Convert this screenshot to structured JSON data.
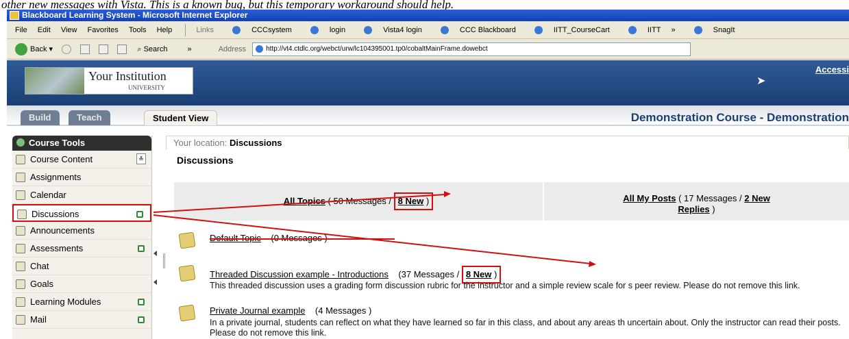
{
  "caption": "other new messages with Vista. This is a known bug, but this temporary workaround should help.",
  "window": {
    "title": "Blackboard Learning System - Microsoft Internet Explorer"
  },
  "menu": {
    "items": [
      "File",
      "Edit",
      "View",
      "Favorites",
      "Tools",
      "Help"
    ],
    "links_label": "Links",
    "links": [
      "CCCsystem",
      "login",
      "Vista4 login",
      "CCC Blackboard",
      "IITT_CourseCart",
      "IITT"
    ],
    "more": "»",
    "snagit": "SnagIt"
  },
  "toolbar": {
    "back": "Back",
    "search": "Search",
    "more": "»",
    "address_label": "Address",
    "address_value": "http://vt4.ctdlc.org/webct/urw/lc104395001.tp0/cobaltMainFrame.dowebct"
  },
  "header": {
    "institution": "Your Institution",
    "institution_sub": "UNIVERSITY",
    "accessibility": "Accessi",
    "course_title": "Demonstration Course - Demonstration",
    "tabs": [
      "Build",
      "Teach",
      "Student View"
    ]
  },
  "sidebar": {
    "title": "Course Tools",
    "items": [
      {
        "label": "Course Content",
        "icon": "course-content-icon"
      },
      {
        "label": "Assignments",
        "icon": "assignments-icon"
      },
      {
        "label": "Calendar",
        "icon": "calendar-icon"
      },
      {
        "label": "Discussions",
        "icon": "discussions-icon",
        "has_new": true,
        "highlighted": true
      },
      {
        "label": "Announcements",
        "icon": "announcements-icon"
      },
      {
        "label": "Assessments",
        "icon": "assessments-icon",
        "has_new": true
      },
      {
        "label": "Chat",
        "icon": "chat-icon"
      },
      {
        "label": "Goals",
        "icon": "goals-icon"
      },
      {
        "label": "Learning Modules",
        "icon": "learning-modules-icon",
        "has_new": true
      },
      {
        "label": "Mail",
        "icon": "mail-icon",
        "has_new": true
      }
    ]
  },
  "content": {
    "location_prefix": "Your location:",
    "location": "Discussions",
    "title": "Discussions",
    "all_topics": {
      "label": "All Topics",
      "count": "( 50 Messages /",
      "new": "8 New",
      "close": ")"
    },
    "my_posts": {
      "label": "All My Posts",
      "count": "( 17 Messages /",
      "new": "2 New",
      "new_line2": "Replies",
      "close": ")"
    },
    "topics": [
      {
        "title": "Default Topic",
        "count": "(0 Messages )",
        "desc": ""
      },
      {
        "title": "Threaded Discussion example - Introductions",
        "count": "(37 Messages /",
        "new": "8 New",
        "close": ")",
        "desc": "This threaded discussion uses a grading form discussion rubric for the instructor and a simple review scale for s peer review. Please do not remove this link."
      },
      {
        "title": "Private Journal example",
        "count": "(4 Messages )",
        "desc": "In a private journal, students can reflect on what they have learned so far in this class, and about any areas th uncertain about. Only the instructor can read their posts. Please do not remove this link."
      }
    ]
  },
  "colors": {
    "highlight": "#d10f0f",
    "header_blue": "#1b3f74",
    "new_indicator": "#2e8b2e"
  }
}
